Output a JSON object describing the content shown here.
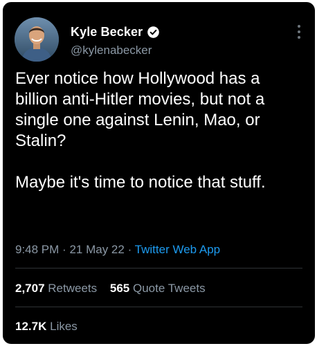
{
  "author": {
    "display_name": "Kyle Becker",
    "handle": "@kylenabecker",
    "verified_icon": "verified-badge-icon",
    "avatar_icon": "profile-photo"
  },
  "tweet": {
    "text": "Ever notice how Hollywood has a billion anti-Hitler movies, but not a single one against Lenin, Mao, or Stalin?\n\nMaybe it's time to notice that stuff.",
    "time": "9:48 PM",
    "date": "21 May 22",
    "separator": "·",
    "source": "Twitter Web App"
  },
  "stats": {
    "retweets_count": "2,707",
    "retweets_label": "Retweets",
    "quote_tweets_count": "565",
    "quote_tweets_label": "Quote Tweets",
    "likes_count": "12.7K",
    "likes_label": "Likes"
  },
  "colors": {
    "background": "#000000",
    "text_primary": "#ffffff",
    "text_secondary": "#8b98a5",
    "link": "#1d9bf0",
    "divider": "#2f3336"
  }
}
